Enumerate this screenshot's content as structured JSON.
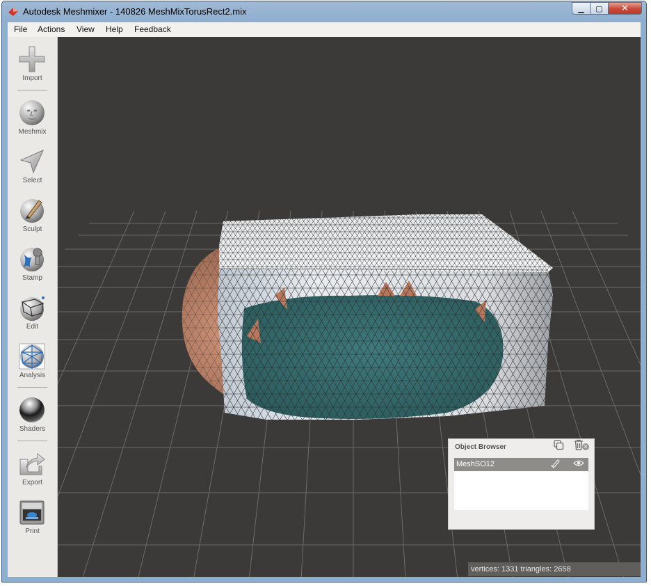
{
  "window": {
    "title": "Autodesk Meshmixer - 140826 MeshMixTorusRect2.mix",
    "minimize_glyph": "▁",
    "maximize_glyph": "▢",
    "close_glyph": "✕"
  },
  "menu": [
    "File",
    "Actions",
    "View",
    "Help",
    "Feedback"
  ],
  "toolbar": [
    {
      "label": "Import",
      "icon": "plus-icon"
    },
    {
      "label": "Meshmix",
      "icon": "face-sphere-icon"
    },
    {
      "label": "Select",
      "icon": "arrow-pointer-icon"
    },
    {
      "label": "Sculpt",
      "icon": "brush-sphere-icon"
    },
    {
      "label": "Stamp",
      "icon": "stamp-icon"
    },
    {
      "label": "Edit",
      "icon": "wire-cube-icon"
    },
    {
      "label": "Analysis",
      "icon": "mesh-sphere-icon"
    },
    {
      "label": "Shaders",
      "icon": "chrome-sphere-icon"
    },
    {
      "label": "Export",
      "icon": "export-arrow-icon"
    },
    {
      "label": "Print",
      "icon": "printer-icon"
    }
  ],
  "object_browser": {
    "title": "Object Browser",
    "close_glyph": "×",
    "objects": [
      {
        "name": "MeshSO12",
        "selected": true
      }
    ]
  },
  "status": {
    "text": "vertices: 1331 triangles: 2658"
  },
  "colors": {
    "viewport_bg": "#3b3a38",
    "grid": "#6d6b68",
    "mesh_white": "#eef0f2",
    "mesh_teal": "#3d7577",
    "torus_orange": "#b9785c"
  }
}
